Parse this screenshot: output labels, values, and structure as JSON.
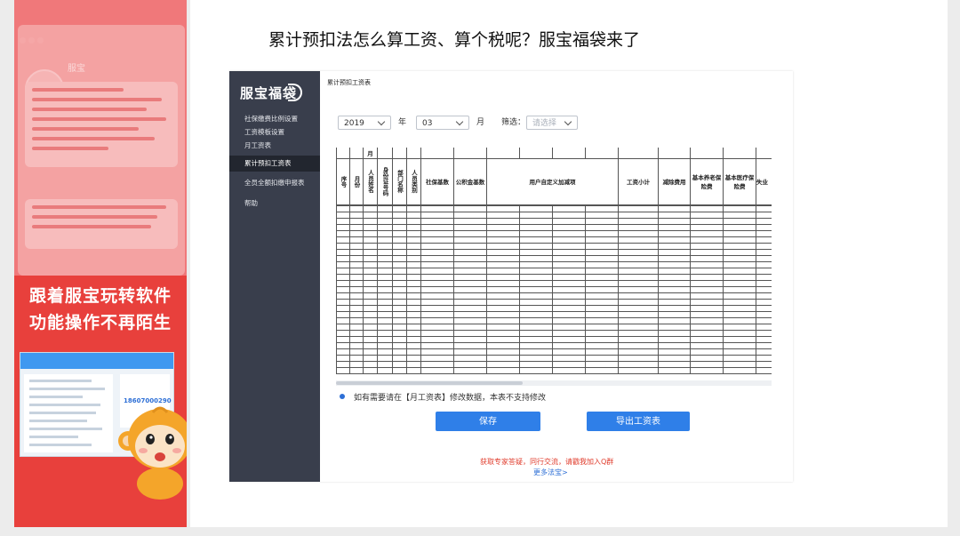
{
  "slide": {
    "title": "累计预扣法怎么算工资、算个税呢？服宝福袋来了"
  },
  "promo": {
    "banner_line1": "跟着服宝玩转软件",
    "banner_line2": "功能操作不再陌生",
    "top_bubble_title": "服宝",
    "shot_phone": "18607000290"
  },
  "app": {
    "logo": "服宝福袋",
    "nav": [
      {
        "label": "社保缴费比例设置"
      },
      {
        "label": "工资模板设置"
      },
      {
        "label": "月工资表"
      },
      {
        "label": "累计预扣工资表"
      },
      {
        "label": "全员全额扣缴申报表"
      },
      {
        "label": "帮助"
      }
    ],
    "page_title": "累计预扣工资表",
    "filters": {
      "year": "2019",
      "year_unit": "年",
      "month": "03",
      "month_unit": "月",
      "filter_label": "筛选：",
      "filter_placeholder": "请选择"
    },
    "table": {
      "top_label": "月",
      "headers": [
        "序号",
        "月份",
        "人员姓名",
        "身份证号码",
        "部门名称",
        "人员类别",
        "社保基数",
        "公积金基数",
        "用户自定义加减项",
        "工资小计",
        "减除费用",
        "基本养老保险费",
        "基本医疗保险费",
        "失业"
      ]
    },
    "notice": "如有需要请在【月工资表】修改数据，本表不支持修改",
    "buttons": {
      "save": "保存",
      "export": "导出工资表"
    },
    "footer_text": "获取专家答疑，同行交流，请戳我加入Q群",
    "footer_link": "更多法宝>"
  },
  "colors": {
    "primary": "#2f7fe8",
    "sidebar": "#393e4c",
    "promo_red": "#e8403c",
    "footer_red": "#e03c2c"
  }
}
